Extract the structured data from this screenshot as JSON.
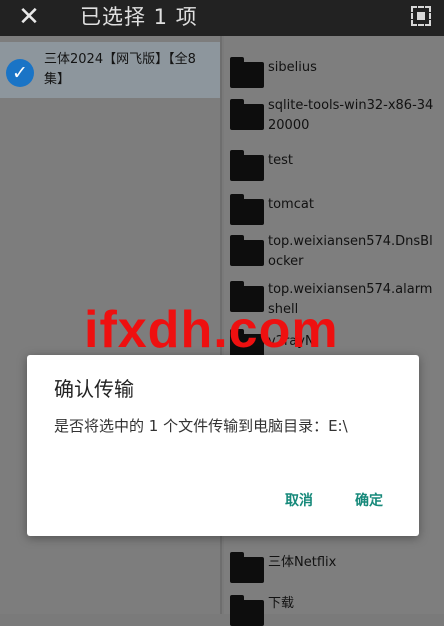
{
  "topbar": {
    "close_glyph": "✕",
    "title": "已选择 1 项",
    "select_all_icon": "select-all-icon"
  },
  "left_pane": {
    "selected_file": {
      "name": "三体2024【网飞版】【全8集】",
      "checked": true
    }
  },
  "right_pane": {
    "folders": [
      {
        "name": "sibelius"
      },
      {
        "name": "sqlite-tools-win32-x86-3420000"
      },
      {
        "name": "test"
      },
      {
        "name": "tomcat"
      },
      {
        "name": "top.weixiansen574.DnsBlocker"
      },
      {
        "name": "top.weixiansen574.alarmshell"
      },
      {
        "name": "v2rayN"
      },
      {
        "name": "三体Netflix"
      },
      {
        "name": "下载"
      }
    ]
  },
  "watermark": "ifxdh.com",
  "dialog": {
    "title": "确认传输",
    "message": "是否将选中的 1 个文件传输到电脑目录：E:\\",
    "cancel_label": "取消",
    "confirm_label": "确定"
  },
  "colors": {
    "accent": "#16897a",
    "check": "#1a74c6",
    "watermark": "#ee1010"
  }
}
